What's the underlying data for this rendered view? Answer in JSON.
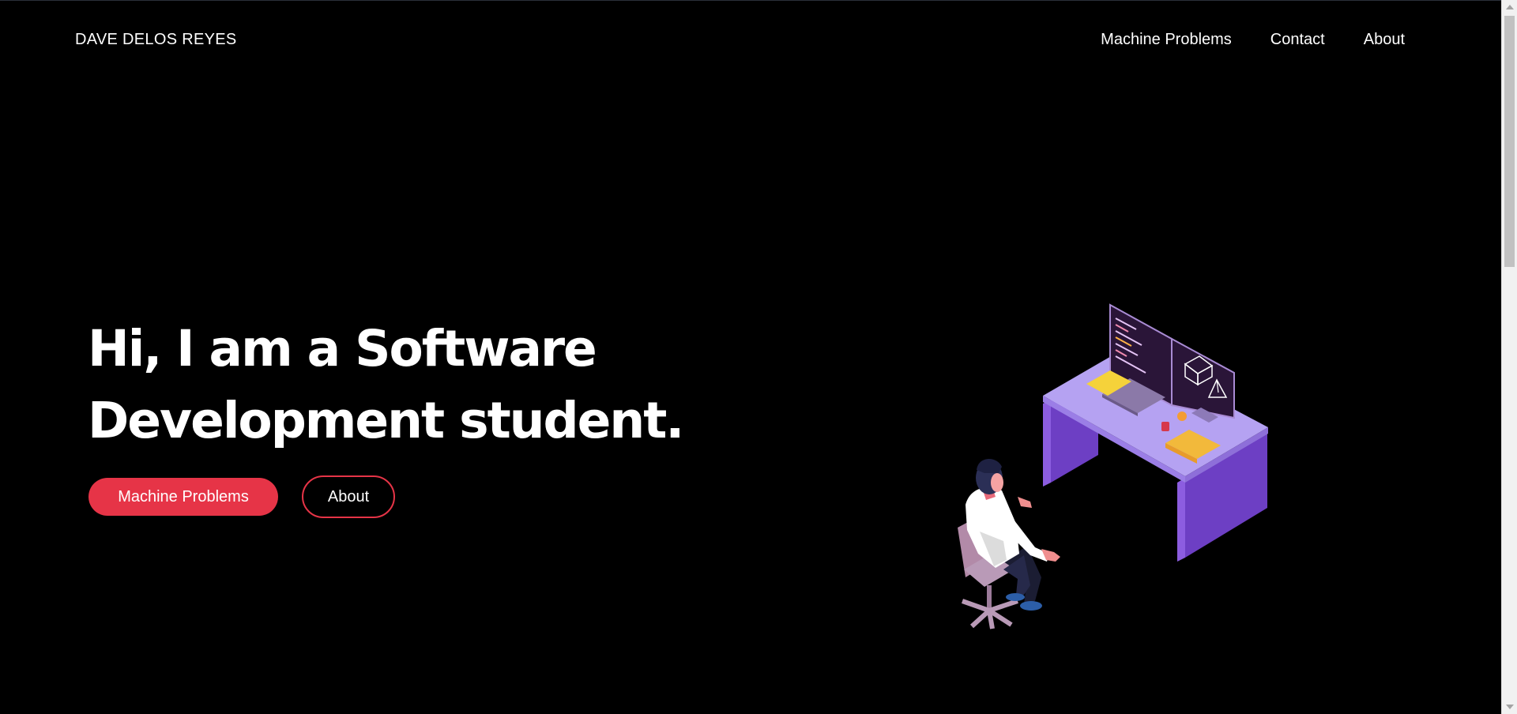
{
  "navbar": {
    "brand": "DAVE DELOS REYES",
    "links": [
      {
        "label": "Machine Problems"
      },
      {
        "label": "Contact"
      },
      {
        "label": "About"
      }
    ]
  },
  "hero": {
    "title": "Hi, I am a Software Development student.",
    "primary_button": "Machine Problems",
    "secondary_button": "About"
  },
  "colors": {
    "background": "#000000",
    "accent": "#e63447",
    "desk_top": "#b5a2f2",
    "desk_side": "#6d3fc4"
  },
  "illustration": {
    "icon": "developer-at-desk-illustration"
  }
}
